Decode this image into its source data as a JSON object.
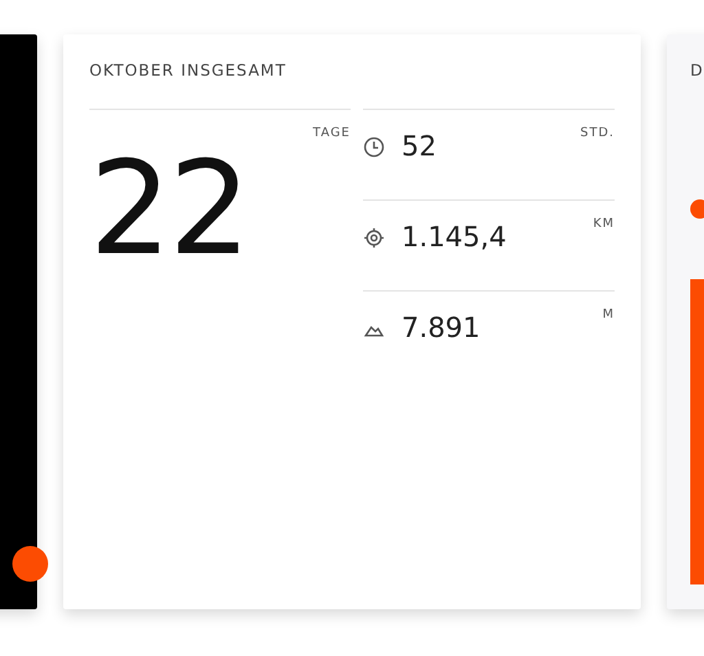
{
  "month_total": {
    "title": "OKTOBER INSGESAMT",
    "days": {
      "value": "22",
      "unit": "TAGE"
    },
    "stats": [
      {
        "kind": "time",
        "value": "52",
        "unit": "STD."
      },
      {
        "kind": "distance",
        "value": "1.145,4",
        "unit": "KM"
      },
      {
        "kind": "elevation",
        "value": "7.891",
        "unit": "M"
      }
    ]
  },
  "next_card": {
    "title": "D"
  }
}
